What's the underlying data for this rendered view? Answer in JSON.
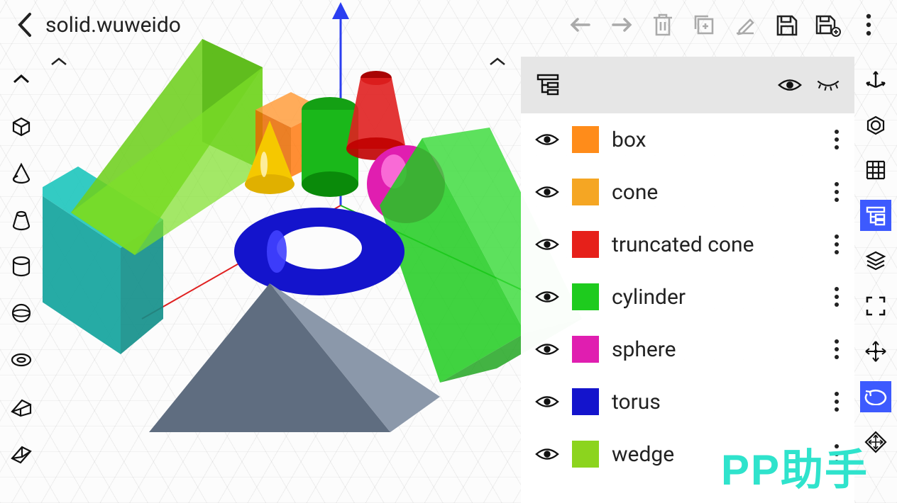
{
  "header": {
    "filename": "solid.wuweido"
  },
  "layers": [
    {
      "name": "box",
      "color": "#ff8c1a"
    },
    {
      "name": "cone",
      "color": "#f5a623"
    },
    {
      "name": "truncated cone",
      "color": "#e6201a"
    },
    {
      "name": "cylinder",
      "color": "#1ecb1e"
    },
    {
      "name": "sphere",
      "color": "#e01eb0"
    },
    {
      "name": "torus",
      "color": "#1414cc"
    },
    {
      "name": "wedge",
      "color": "#8cd41e"
    }
  ],
  "watermark": "PP助手"
}
